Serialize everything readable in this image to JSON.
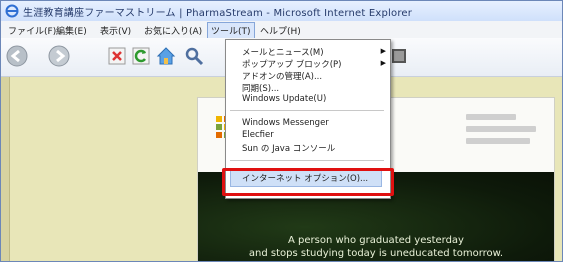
{
  "window": {
    "title": "生涯教育講座ファーマストリーム | PharmaStream - Microsoft Internet Explorer"
  },
  "menubar": {
    "items": [
      {
        "label": "ファイル(F)"
      },
      {
        "label": "編集(E)"
      },
      {
        "label": "表示(V)"
      },
      {
        "label": "お気に入り(A)"
      },
      {
        "label": "ツール(T)"
      },
      {
        "label": "ヘルプ(H)"
      }
    ]
  },
  "toolbar": {
    "buttons": [
      {
        "name": "back-button",
        "icon": "back-arrow-icon"
      },
      {
        "name": "forward-button",
        "icon": "forward-arrow-icon"
      },
      {
        "name": "refresh-button",
        "icon": "refresh-icon"
      },
      {
        "name": "home-button",
        "icon": "home-icon"
      },
      {
        "name": "search-button",
        "icon": "search-icon"
      },
      {
        "name": "history-button",
        "icon": "history-icon"
      }
    ]
  },
  "tools_menu": {
    "items": [
      {
        "label": "メールとニュース(M)",
        "submenu": true
      },
      {
        "label": "ポップアップ ブロック(P)",
        "submenu": true
      },
      {
        "label": "アドオンの管理(A)..."
      },
      {
        "label": "同期(S)..."
      },
      {
        "label": "Windows Update(U)"
      },
      {
        "label": "Windows Messenger"
      },
      {
        "label": "Elecfier"
      },
      {
        "label": "Sun の Java コンソール"
      },
      {
        "label": "インターネット オプション(O)..."
      }
    ]
  },
  "page": {
    "quote_line1": "A person who graduated yesterday",
    "quote_line2": "and stops studying today is uneducated tomorrow."
  },
  "colors": {
    "highlight_red": "#e01010",
    "content_bg": "#e8e6b8",
    "dark_panel": "#0e1a0a"
  }
}
